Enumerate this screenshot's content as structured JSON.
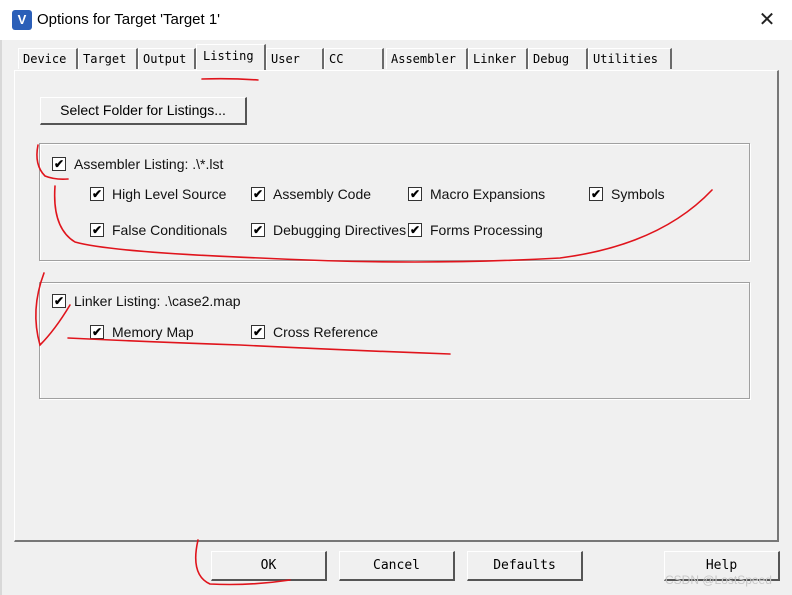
{
  "window": {
    "title": "Options for Target 'Target 1'",
    "close_glyph": "✕",
    "app_icon_letter": "V"
  },
  "tabs": [
    {
      "label": "Device"
    },
    {
      "label": "Target"
    },
    {
      "label": "Output"
    },
    {
      "label": "Listing",
      "active": true
    },
    {
      "label": "User"
    },
    {
      "label": "CC"
    },
    {
      "label": "Assembler"
    },
    {
      "label": "Linker"
    },
    {
      "label": "Debug"
    },
    {
      "label": "Utilities"
    }
  ],
  "listing": {
    "select_folder_label": "Select Folder for Listings...",
    "assembler": {
      "label": "Assembler Listing:  .\\*.lst",
      "checked": true,
      "options": [
        {
          "label": "High Level Source",
          "checked": true
        },
        {
          "label": "Assembly Code",
          "checked": true
        },
        {
          "label": "Macro Expansions",
          "checked": true
        },
        {
          "label": "Symbols",
          "checked": true
        },
        {
          "label": "False Conditionals",
          "checked": true
        },
        {
          "label": "Debugging Directives",
          "checked": true
        },
        {
          "label": "Forms Processing",
          "checked": true
        }
      ]
    },
    "linker": {
      "label": "Linker Listing:  .\\case2.map",
      "checked": true,
      "options": [
        {
          "label": "Memory Map",
          "checked": true
        },
        {
          "label": "Cross Reference",
          "checked": true
        }
      ]
    }
  },
  "footer": {
    "ok": "OK",
    "cancel": "Cancel",
    "defaults": "Defaults",
    "help": "Help"
  },
  "check_glyph": "✔",
  "watermark": "CSDN @LostSpeed",
  "colors": {
    "annotation": "#e0141c",
    "icon": "#2b5fb8"
  }
}
